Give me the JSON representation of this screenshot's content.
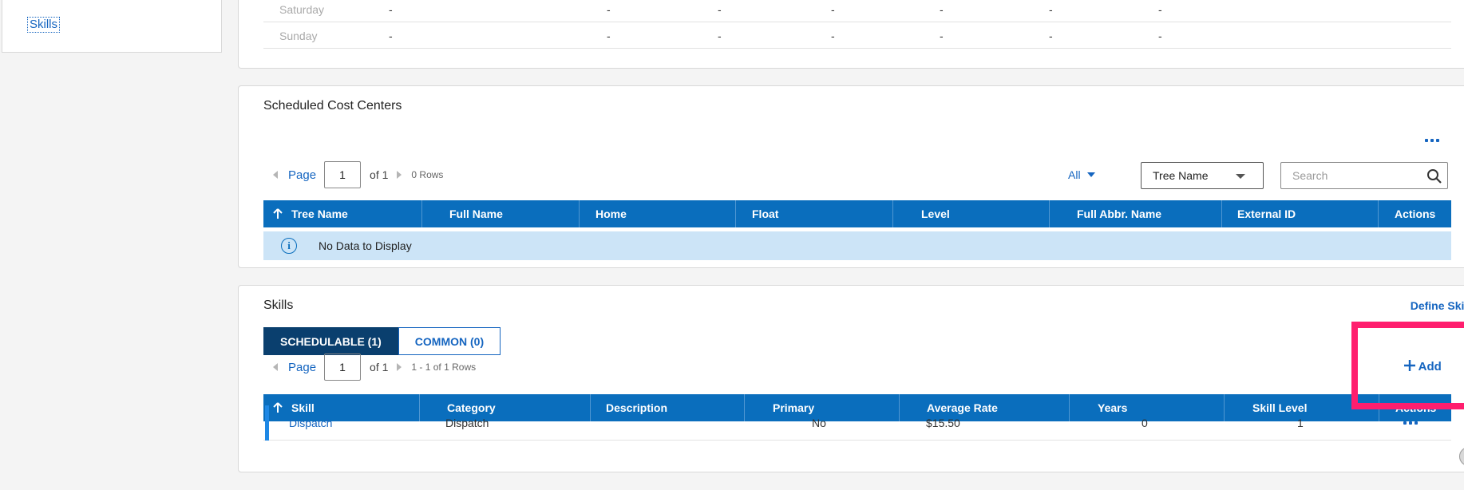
{
  "sidebar": {
    "item_label": "Skills"
  },
  "availability": {
    "rows": [
      {
        "day": "Saturday",
        "cells": [
          "-",
          "-",
          "-",
          "-",
          "-",
          "-",
          "-"
        ]
      },
      {
        "day": "Sunday",
        "cells": [
          "-",
          "-",
          "-",
          "-",
          "-",
          "-",
          "-"
        ]
      }
    ]
  },
  "cost_centers": {
    "title": "Scheduled Cost Centers",
    "pager": {
      "label": "Page",
      "value": "1",
      "of": "of 1",
      "rows": "0 Rows"
    },
    "filter_all": "All",
    "sort_select": "Tree Name",
    "search_placeholder": "Search",
    "columns": [
      "Tree Name",
      "Full Name",
      "Home",
      "Float",
      "Level",
      "Full Abbr. Name",
      "External ID",
      "Actions"
    ],
    "no_data": "No Data to Display"
  },
  "skills": {
    "title": "Skills",
    "define_link": "Define Skills",
    "tabs": [
      "SCHEDULABLE (1)",
      "COMMON (0)"
    ],
    "add_label": "Add",
    "pager": {
      "label": "Page",
      "value": "1",
      "of": "of 1",
      "rows": "1 - 1 of 1 Rows"
    },
    "columns": [
      "Skill",
      "Category",
      "Description",
      "Primary",
      "Average Rate",
      "Years",
      "Skill Level",
      "Actions"
    ],
    "rows": [
      {
        "skill": "Dispatch",
        "category": "Dispatch",
        "description": "",
        "primary": "No",
        "average_rate": "$15.50",
        "years": "0",
        "skill_level": "1"
      }
    ]
  },
  "colors": {
    "header_blue": "#0a6ebd",
    "tab_dark": "#0a3f6e",
    "link": "#1565c0",
    "highlight": "#ff1e6e",
    "nodata_bg": "#cce4f7"
  }
}
